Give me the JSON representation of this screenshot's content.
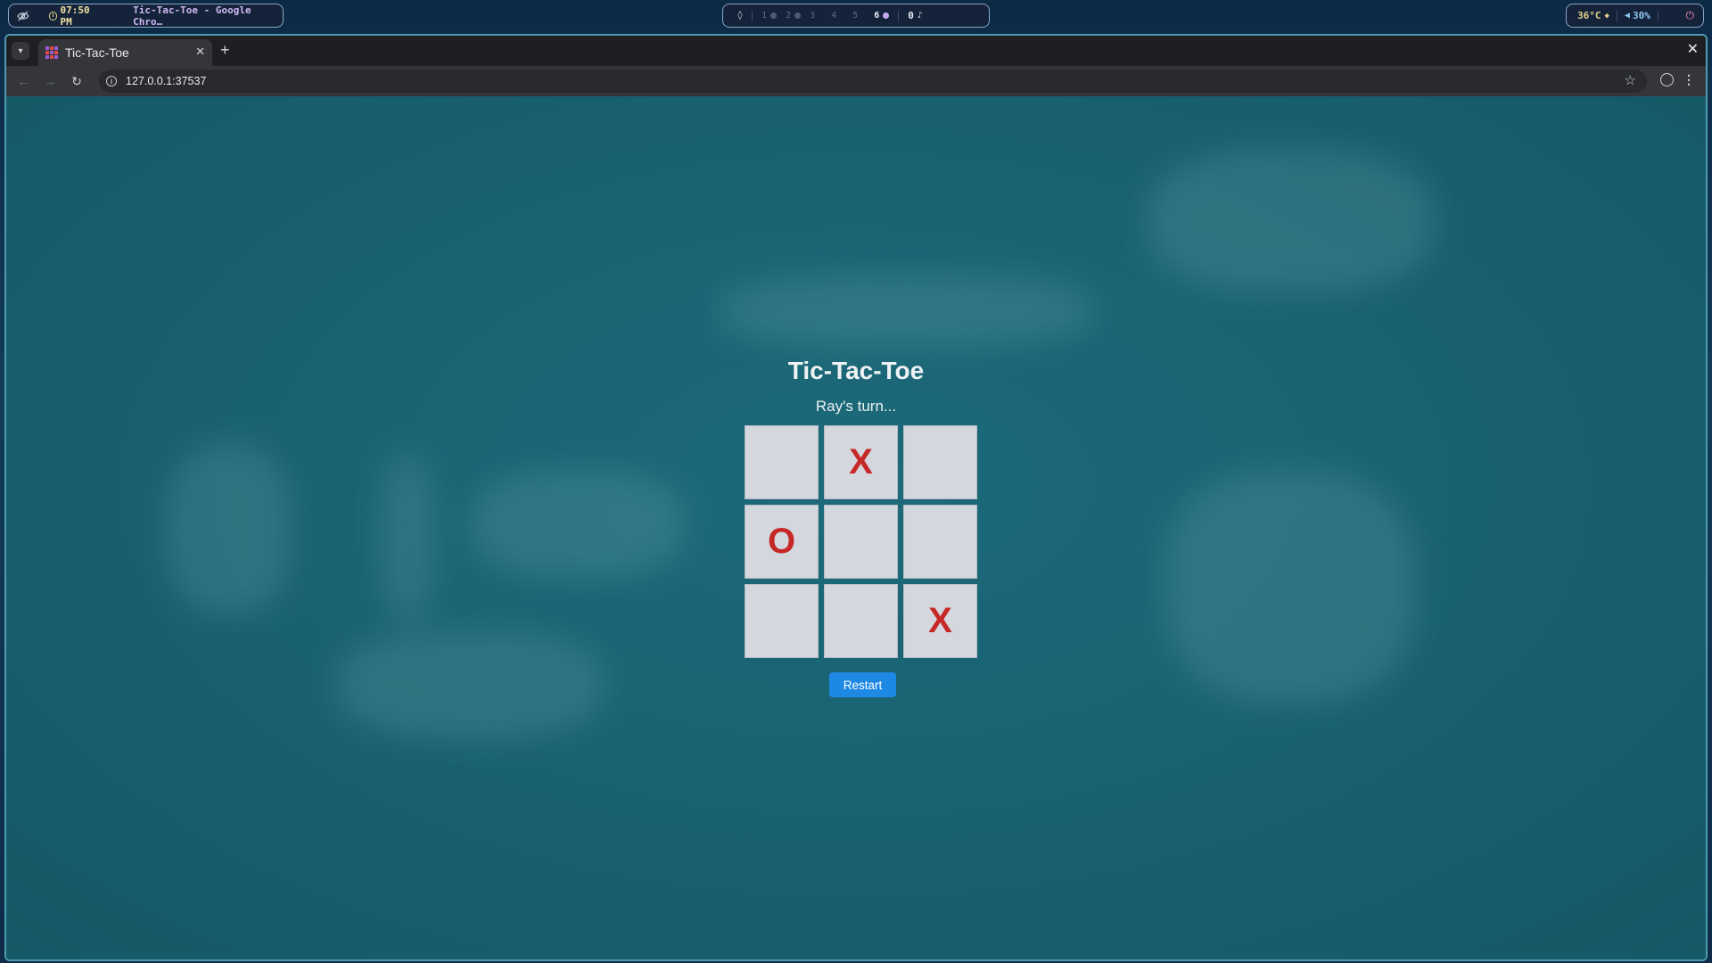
{
  "system_bar": {
    "time": "07:50 PM",
    "window_title": "Tic-Tac-Toe - Google Chro…",
    "workspaces": [
      {
        "label": "1",
        "active": false
      },
      {
        "label": "2",
        "active": false
      },
      {
        "label": "3",
        "active": false
      },
      {
        "label": "4",
        "active": false
      },
      {
        "label": "5",
        "active": false
      },
      {
        "label": "6",
        "active": true
      }
    ],
    "notification_count": "0",
    "temperature": "36°C",
    "volume": "30%"
  },
  "browser": {
    "tab_title": "Tic-Tac-Toe",
    "url": "127.0.0.1:37537"
  },
  "game": {
    "title": "Tic-Tac-Toe",
    "status": "Ray's turn...",
    "board": [
      "",
      "X",
      "",
      "O",
      "",
      "",
      "",
      "",
      "X"
    ],
    "restart_label": "Restart",
    "mark_color": "#c62828",
    "button_color": "#1e88e5"
  }
}
